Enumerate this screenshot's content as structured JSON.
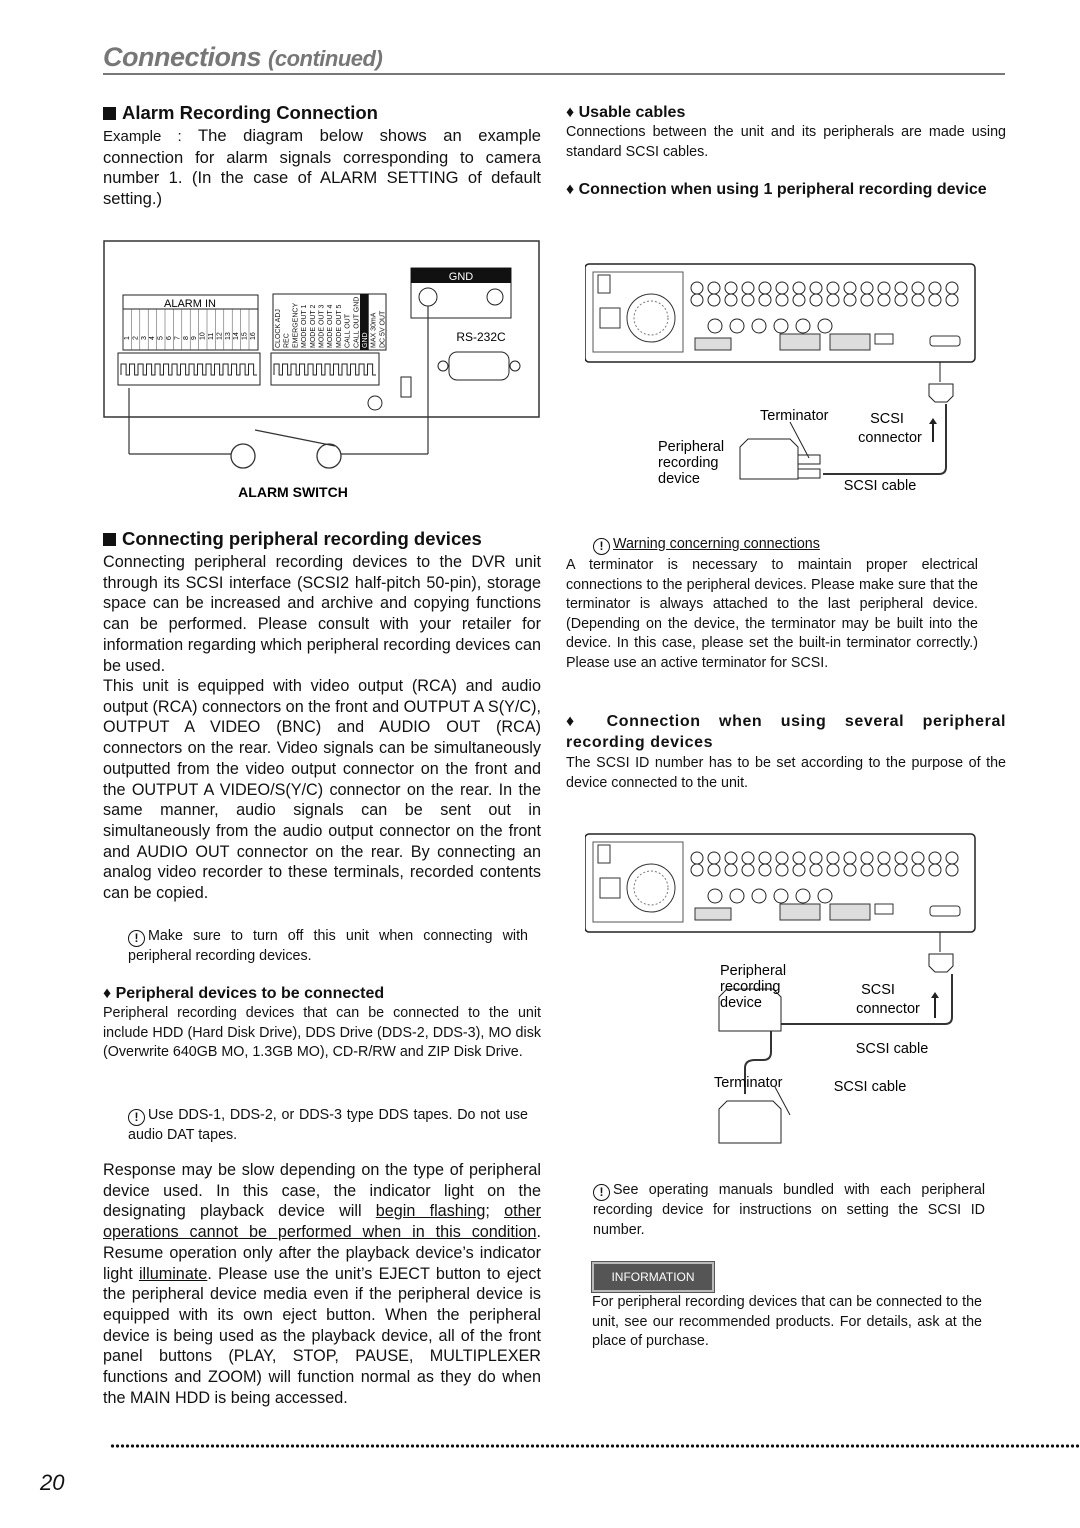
{
  "header": {
    "title": "Connections",
    "subtitle": "(continued)"
  },
  "left": {
    "alarm": {
      "heading": "Alarm Recording Connection",
      "example_label": "Example :",
      "example_text": "The diagram below shows an example connection for alarm signals corresponding to camera number 1. (In the case of ALARM SETTING of default setting.)",
      "diagram": {
        "alarm_in": "ALARM IN",
        "numbers": [
          "1",
          "2",
          "3",
          "4",
          "5",
          "6",
          "7",
          "8",
          "9",
          "10",
          "11",
          "12",
          "13",
          "14",
          "15",
          "16"
        ],
        "terminals": [
          "CLOCK ADJ",
          "REC",
          "EMERGENCY",
          "MODE OUT 1",
          "MODE OUT 2",
          "MODE OUT 3",
          "MODE OUT 4",
          "MODE OUT 5",
          "CALL OUT",
          "CALL OUT GND",
          "GND",
          "MAX 30mA",
          "DC 5V OUT"
        ],
        "gnd": "GND",
        "rs232c": "RS-232C",
        "switch_label": "ALARM SWITCH"
      }
    },
    "peripheral": {
      "heading": "Connecting peripheral recording devices",
      "p1": "Connecting peripheral recording devices to the DVR unit through its SCSI interface (SCSI2 half-pitch 50-pin), storage space can be increased and archive and copying functions can be performed. Please consult with your retailer for information regarding which peripheral recording devices can be used.",
      "p2": "This unit is equipped with video output (RCA) and audio output (RCA) connectors on the front and OUTPUT A S(Y/C), OUTPUT A VIDEO (BNC) and AUDIO OUT (RCA) connectors on the rear. Video signals can be simultaneously outputted from the video output connector on the front and the OUTPUT A VIDEO/S(Y/C) connector on the rear. In the same manner, audio signals can be sent out in simultaneously from the audio output connector on the front and AUDIO OUT connector on the rear. By connecting an analog video recorder to these terminals, recorded contents can be copied.",
      "note1": "Make sure to turn off this unit when connecting with peripheral recording devices.",
      "devices_heading": "Peripheral devices to be connected",
      "devices_text": "Peripheral recording devices that can be connected to the unit include HDD (Hard Disk Drive), DDS Drive (DDS-2, DDS-3), MO disk (Overwrite 640GB MO, 1.3GB MO), CD-R/RW and ZIP Disk Drive.",
      "note2": "Use DDS-1, DDS-2, or DDS-3 type DDS tapes. Do not use audio DAT tapes.",
      "resp_a": "Response may be slow depending on the type of peripheral device used. In this case, the indicator light on the designating playback device will ",
      "resp_u1": "begin flashing",
      "resp_b": "; ",
      "resp_u2": "other operations cannot be performed when in this condition",
      "resp_c": ". Resume operation only after the playback device’s indicator light ",
      "resp_u3": "illuminate",
      "resp_d": ". Please use the unit’s EJECT button to eject the peripheral device media even if the peripheral device is equipped with its own eject button. When the peripheral device is being used as the playback device, all of the front panel buttons (PLAY, STOP, PAUSE, MULTIPLEXER functions and ZOOM) will function normal as they do when the MAIN HDD is being accessed."
    }
  },
  "right": {
    "usable_heading": "Usable cables",
    "usable_text": "Connections between the unit and its peripherals are made using standard SCSI cables.",
    "one_heading": "Connection when using 1 peripheral recording device",
    "diagram1": {
      "terminator": "Terminator",
      "scsi": "SCSI",
      "connector": "connector",
      "peripheral": "Peripheral",
      "recording": "recording",
      "device": "device",
      "cable": "SCSI cable"
    },
    "warning_title": "Warning concerning connections",
    "warning_text": "A terminator is necessary to maintain proper electrical connections to the peripheral devices. Please make sure that the terminator is always attached to the last peripheral device. (Depending on the device, the terminator may be built into the device. In this case, please set the built-in terminator correctly.) Please use an active terminator for SCSI.",
    "several_heading": "Connection when using several peripheral recording devices",
    "several_text": "The SCSI ID number has to be set according to the purpose of the device connected to the unit.",
    "diagram2": {
      "peripheral": "Peripheral",
      "recording": "recording",
      "device": "device",
      "scsi": "SCSI",
      "connector": "connector",
      "cable1": "SCSI cable",
      "terminator": "Terminator",
      "cable2": "SCSI cable"
    },
    "note3": "See operating manuals bundled with each peripheral recording device for instructions on setting the SCSI ID number.",
    "info_label": "INFORMATION",
    "info_text": "For peripheral recording devices that can be connected to the unit, see our recommended products. For details, ask at the place of purchase."
  },
  "footer": {
    "page_number": "20"
  }
}
